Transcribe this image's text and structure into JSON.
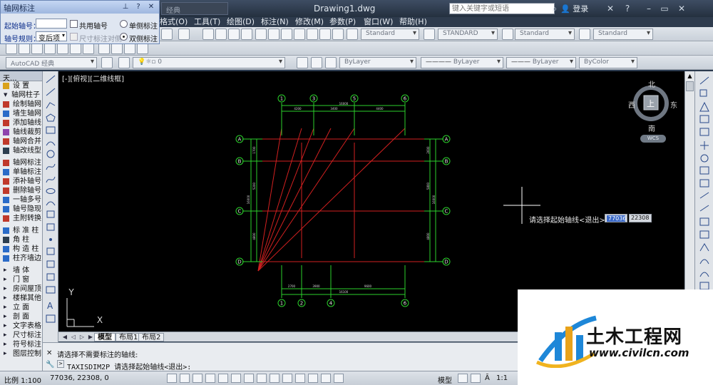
{
  "window": {
    "title": "Drawing1.dwg",
    "workspace": "经典",
    "search_placeholder": "键入关键字或短语",
    "login": "登录"
  },
  "menu": {
    "items": [
      "格式(O)",
      "工具(T)",
      "绘图(D)",
      "标注(N)",
      "修改(M)",
      "参数(P)",
      "窗口(W)",
      "帮助(H)"
    ]
  },
  "dialog": {
    "title": "轴网标注",
    "start_label": "起始轴号：",
    "start_value": "",
    "shared_label": "共用轴号",
    "single_label": "单侧标注",
    "double_label": "双侧标注",
    "rule_label": "轴号规则：",
    "rule_value": "变后项",
    "dim_label": "尺寸标注对侧"
  },
  "toolbar": {
    "workspace_combo": "AutoCAD 经典",
    "layer_value": "0",
    "text_style": "Standard",
    "dim_style": "STANDARD",
    "table_style": "Standard",
    "multileader_style": "Standard",
    "color": "ByLayer",
    "linetype": "ByLayer",
    "lineweight": "ByLayer",
    "plotstyle": "ByColor"
  },
  "left_panel": {
    "header": "天...",
    "items": [
      {
        "label": "设    置",
        "kind": "cat",
        "color": "#d9a21b"
      },
      {
        "label": "轴网柱子",
        "kind": "sec",
        "color": ""
      },
      {
        "label": "绘制轴网",
        "kind": "item",
        "color": "#c0392b"
      },
      {
        "label": "墙生轴网",
        "kind": "item",
        "color": "#2a6bc8"
      },
      {
        "label": "添加轴线",
        "kind": "item",
        "color": "#c0392b"
      },
      {
        "label": "轴线裁剪",
        "kind": "item",
        "color": "#8e44ad"
      },
      {
        "label": "轴网合并",
        "kind": "item",
        "color": "#c0392b"
      },
      {
        "label": "轴改线型",
        "kind": "item",
        "color": "#2c3e50"
      },
      {
        "label": "",
        "kind": "gap",
        "color": ""
      },
      {
        "label": "轴网标注",
        "kind": "item",
        "color": "#c0392b"
      },
      {
        "label": "单轴标注",
        "kind": "item",
        "color": "#2a6bc8"
      },
      {
        "label": "添补轴号",
        "kind": "item",
        "color": "#c0392b"
      },
      {
        "label": "删除轴号",
        "kind": "item",
        "color": "#c0392b"
      },
      {
        "label": "一轴多号",
        "kind": "item",
        "color": "#2a6bc8"
      },
      {
        "label": "轴号隐现",
        "kind": "item",
        "color": "#2a6bc8"
      },
      {
        "label": "主附转换",
        "kind": "item",
        "color": "#c0392b"
      },
      {
        "label": "",
        "kind": "gap",
        "color": ""
      },
      {
        "label": "标 准 柱",
        "kind": "item",
        "color": "#2a6bc8"
      },
      {
        "label": "角    柱",
        "kind": "item",
        "color": "#2c3e50"
      },
      {
        "label": "构 造 柱",
        "kind": "item",
        "color": "#2a6bc8"
      },
      {
        "label": "柱齐墙边",
        "kind": "item",
        "color": "#2a6bc8"
      },
      {
        "label": "",
        "kind": "gap",
        "color": ""
      },
      {
        "label": "墙    体",
        "kind": "cat",
        "color": ""
      },
      {
        "label": "门    窗",
        "kind": "cat",
        "color": ""
      },
      {
        "label": "房间屋顶",
        "kind": "cat",
        "color": ""
      },
      {
        "label": "楼梯其他",
        "kind": "cat",
        "color": ""
      },
      {
        "label": "立    面",
        "kind": "cat",
        "color": ""
      },
      {
        "label": "剖    面",
        "kind": "cat",
        "color": ""
      },
      {
        "label": "文字表格",
        "kind": "cat",
        "color": ""
      },
      {
        "label": "尺寸标注",
        "kind": "cat",
        "color": ""
      },
      {
        "label": "符号标注",
        "kind": "cat",
        "color": ""
      },
      {
        "label": "图层控制",
        "kind": "cat",
        "color": ""
      }
    ]
  },
  "viewport": {
    "label": "[-][俯视][二维线框]",
    "north": "北",
    "south": "南",
    "east": "东",
    "west": "西",
    "top": "上",
    "wcs": "WCS",
    "prompt": "请选择起始轴线<退出>:",
    "input1": "77036",
    "input2": "22308"
  },
  "drawing": {
    "top_axes": [
      "1",
      "3",
      "5",
      "6"
    ],
    "bottom_axes": [
      "1",
      "2",
      "4",
      "6"
    ],
    "side_axes": [
      "A",
      "B",
      "C",
      "D"
    ],
    "top_dims": [
      "4200",
      "3400",
      "4400"
    ],
    "top_total": "16000",
    "bottom_dims": [
      "2700",
      "3900",
      "9600"
    ],
    "bottom_total": "16100",
    "left_dims": [
      "1700",
      "5200",
      "4800"
    ],
    "left_total": "16000",
    "right_dims": [
      "2600",
      "5800",
      "4800"
    ],
    "right_total": "16000",
    "ucs_x": "X",
    "ucs_y": "Y"
  },
  "tabs": [
    "模型",
    "布局1",
    "布局2"
  ],
  "command": {
    "line1": "请选择不需要标注的轴线:",
    "line2": "TAXISDIM2P 请选择起始轴线<退出>:"
  },
  "status": {
    "scale": "比例 1:100",
    "coords": "77036, 22308, 0",
    "mode": "模型",
    "annoscale": "1:1"
  },
  "watermark": {
    "brand": "土木工程网",
    "url": "www.civilcn.com"
  }
}
